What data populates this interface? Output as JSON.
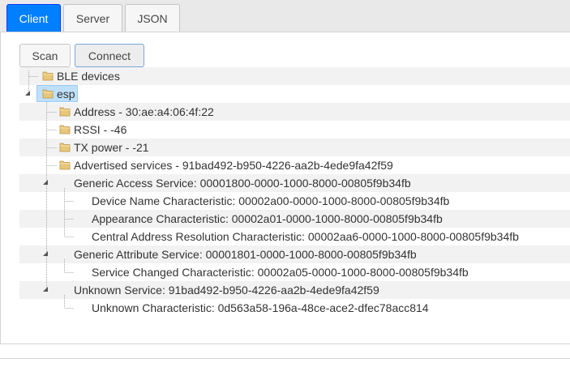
{
  "tabs": [
    {
      "label": "Client",
      "active": true
    },
    {
      "label": "Server",
      "active": false
    },
    {
      "label": "JSON",
      "active": false
    }
  ],
  "toolbar": {
    "scan_label": "Scan",
    "connect_label": "Connect"
  },
  "tree": {
    "root": "BLE devices",
    "device": "esp",
    "device_props": [
      "Address - 30:ae:a4:06:4f:22",
      "RSSI - -46",
      "TX power - -21",
      "Advertised services - 91bad492-b950-4226-aa2b-4ede9fa42f59"
    ],
    "services": [
      {
        "label": "Generic Access Service: 00001800-0000-1000-8000-00805f9b34fb",
        "characteristics": [
          "Device Name Characteristic: 00002a00-0000-1000-8000-00805f9b34fb",
          "Appearance Characteristic: 00002a01-0000-1000-8000-00805f9b34fb",
          "Central Address Resolution Characteristic: 00002aa6-0000-1000-8000-00805f9b34fb"
        ]
      },
      {
        "label": "Generic Attribute Service: 00001801-0000-1000-8000-00805f9b34fb",
        "characteristics": [
          "Service Changed Characteristic: 00002a05-0000-1000-8000-00805f9b34fb"
        ]
      },
      {
        "label": "Unknown Service: 91bad492-b950-4226-aa2b-4ede9fa42f59",
        "characteristics": [
          "Unknown Characteristic: 0d563a58-196a-48ce-ace2-dfec78acc814"
        ]
      }
    ]
  },
  "colors": {
    "active_tab": "#007fff",
    "selection": "#bee0fb",
    "folder": "#e8c77a"
  }
}
